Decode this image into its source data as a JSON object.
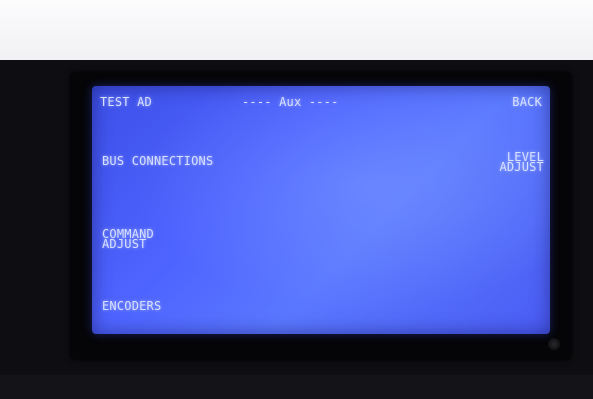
{
  "screen": {
    "header": {
      "left": "TEST AD",
      "center": "---- Aux ----",
      "right": "BACK"
    },
    "menu": {
      "bus_connections": "BUS CONNECTIONS",
      "level_adjust_line1": "LEVEL",
      "level_adjust_line2": "ADJUST",
      "command_adjust_line1": "COMMAND",
      "command_adjust_line2": "ADJUST",
      "encoders": "ENCODERS"
    }
  },
  "colors": {
    "screen_background": "#4e63ff",
    "lcd_text": "#d8e0ff"
  }
}
